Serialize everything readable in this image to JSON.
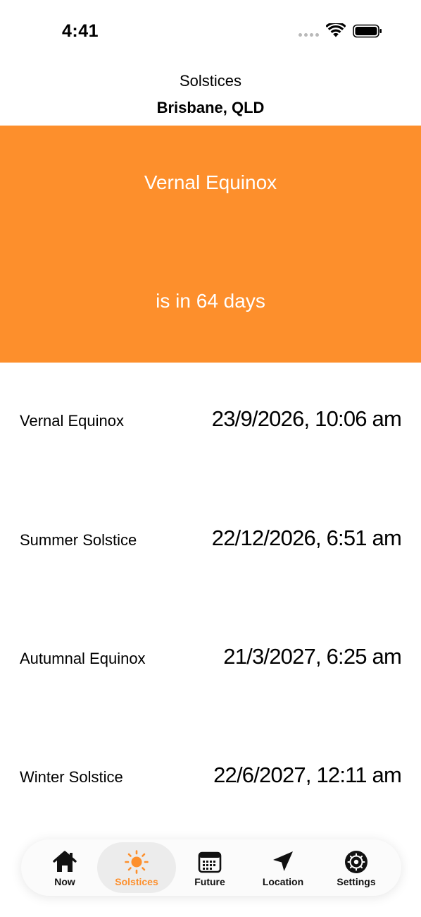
{
  "status_bar": {
    "time": "4:41"
  },
  "header": {
    "title": "Solstices",
    "location": "Brisbane, QLD"
  },
  "banner": {
    "event": "Vernal Equinox",
    "countdown": "is in 64 days",
    "color": "#fd8f2c"
  },
  "events": [
    {
      "name": "Vernal Equinox",
      "date": "23/9/2026, 10:06 am"
    },
    {
      "name": "Summer Solstice",
      "date": "22/12/2026, 6:51 am"
    },
    {
      "name": "Autumnal Equinox",
      "date": "21/3/2027, 6:25 am"
    },
    {
      "name": "Winter Solstice",
      "date": "22/6/2027, 12:11 am"
    }
  ],
  "tabs": [
    {
      "label": "Now",
      "icon": "house-icon",
      "active": false
    },
    {
      "label": "Solstices",
      "icon": "sun-icon",
      "active": true
    },
    {
      "label": "Future",
      "icon": "calendar-icon",
      "active": false
    },
    {
      "label": "Location",
      "icon": "location-arrow-icon",
      "active": false
    },
    {
      "label": "Settings",
      "icon": "gear-icon",
      "active": false
    }
  ],
  "colors": {
    "accent": "#fd8f2c",
    "text": "#000000",
    "background": "#ffffff"
  }
}
